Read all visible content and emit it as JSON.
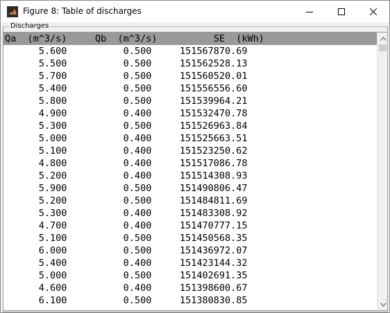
{
  "window": {
    "title": "Figure 8: Table of discharges",
    "icon": "matlab-figure-icon",
    "controls": [
      "minimize-icon",
      "maximize-icon",
      "close-icon"
    ]
  },
  "panel": {
    "title": "Discharges"
  },
  "table": {
    "header": "Qa  (m^3/s)     Qb  (m^3/s)          SE  (kWh)",
    "rows": [
      "      5.600          0.500     151567870.69",
      "      5.500          0.500     151562528.13",
      "      5.700          0.500     151560520.01",
      "      5.400          0.500     151556556.60",
      "      5.800          0.500     151539964.21",
      "      4.900          0.400     151532470.78",
      "      5.300          0.500     151526963.84",
      "      5.000          0.400     151525663.51",
      "      5.100          0.400     151523250.62",
      "      4.800          0.400     151517086.78",
      "      5.200          0.400     151514308.93",
      "      5.900          0.500     151490806.47",
      "      5.200          0.500     151484811.69",
      "      5.300          0.400     151483308.92",
      "      4.700          0.400     151470777.15",
      "      5.100          0.500     151450568.35",
      "      6.000          0.500     151436972.07",
      "      5.400          0.400     151423144.32",
      "      5.000          0.500     151402691.35",
      "      4.600          0.400     151398600.67",
      "      6.100          0.500     151380830.85"
    ]
  },
  "colors": {
    "header_bg": "#999999",
    "list_bg": "#ffffff",
    "window_bg": "#f0f0f0"
  }
}
